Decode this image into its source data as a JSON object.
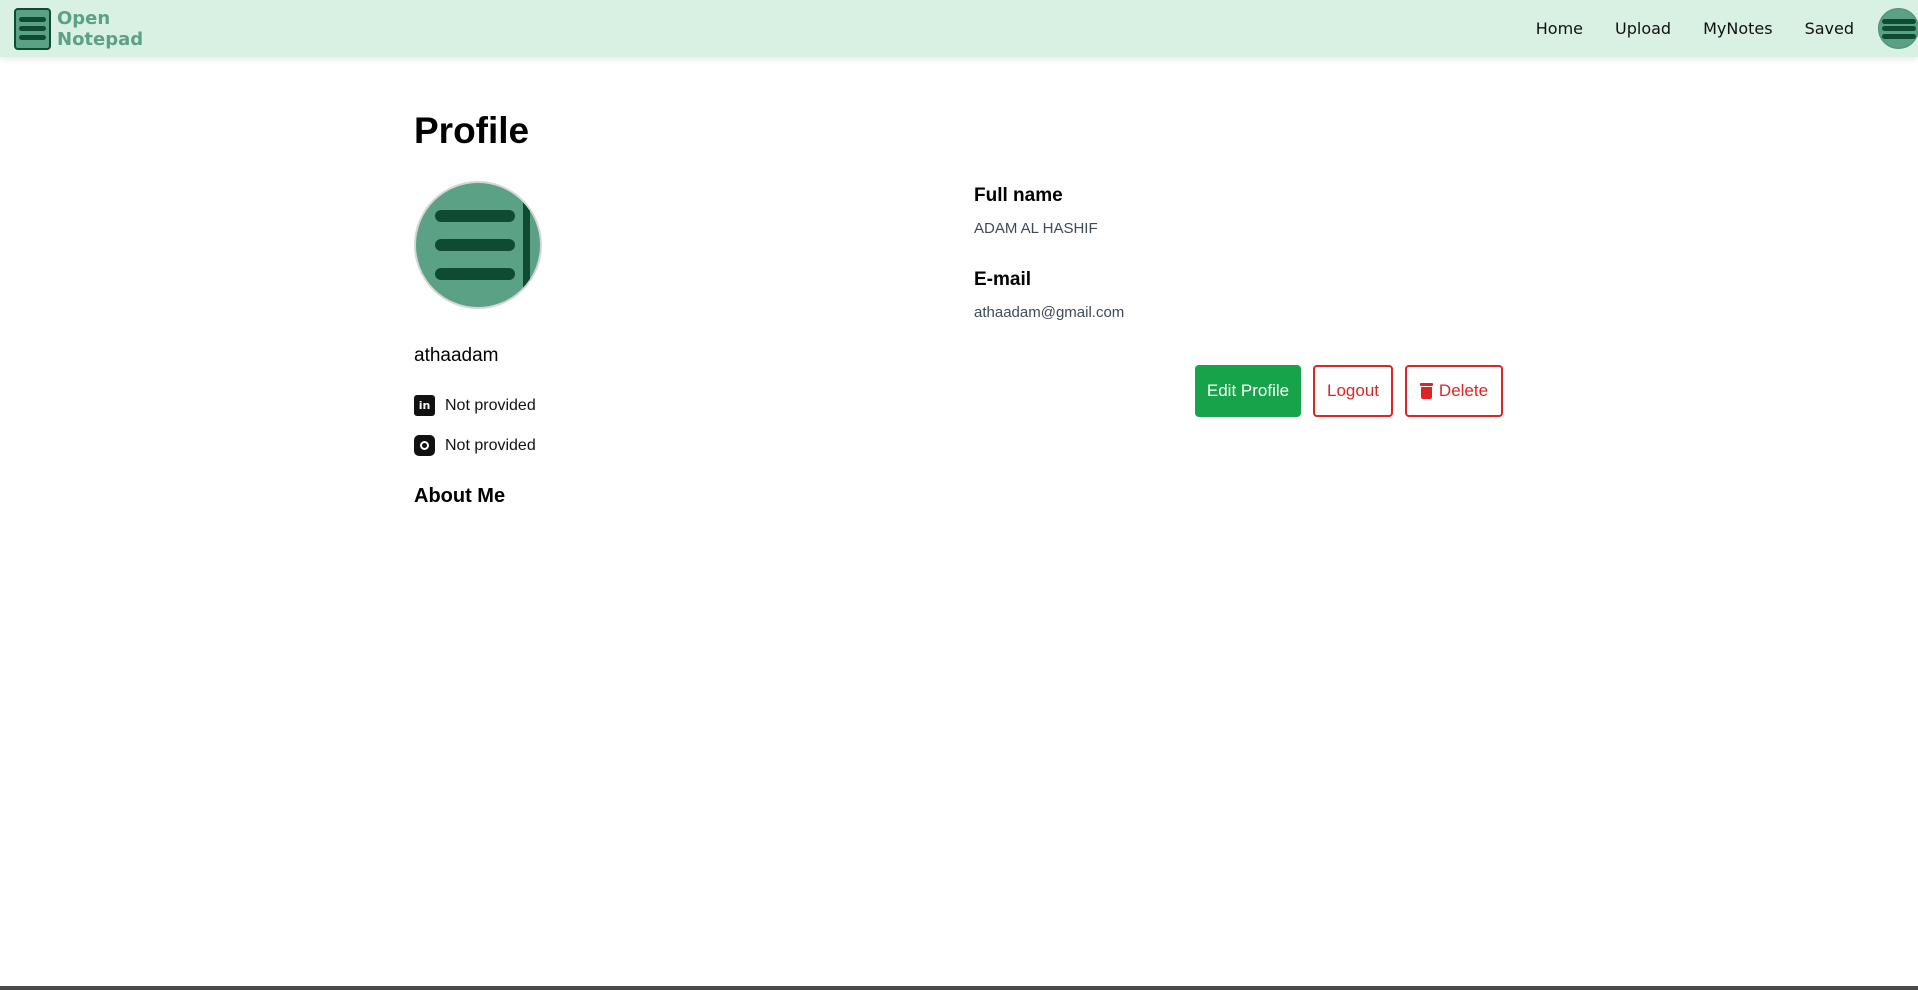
{
  "header": {
    "brand": {
      "line1": "Open",
      "line2": "Notepad"
    },
    "nav": [
      {
        "label": "Home"
      },
      {
        "label": "Upload"
      },
      {
        "label": "MyNotes"
      },
      {
        "label": "Saved"
      }
    ],
    "background_color": "#d9f1e3",
    "brand_color": "#5aa186"
  },
  "profile": {
    "title": "Profile",
    "username": "athaadam",
    "linkedin": {
      "icon": "linkedin-icon",
      "value": "Not provided"
    },
    "instagram": {
      "icon": "instagram-icon",
      "value": "Not provided"
    },
    "about_title": "About Me",
    "fields": {
      "fullname_label": "Full name",
      "fullname_value": "ADAM AL HASHIF",
      "email_label": "E-mail",
      "email_value": "athaadam@gmail.com"
    }
  },
  "actions": {
    "edit_label": "Edit Profile",
    "logout_label": "Logout",
    "delete_label": "Delete",
    "edit_color": "#17a34a",
    "danger_color": "#dc2626"
  }
}
